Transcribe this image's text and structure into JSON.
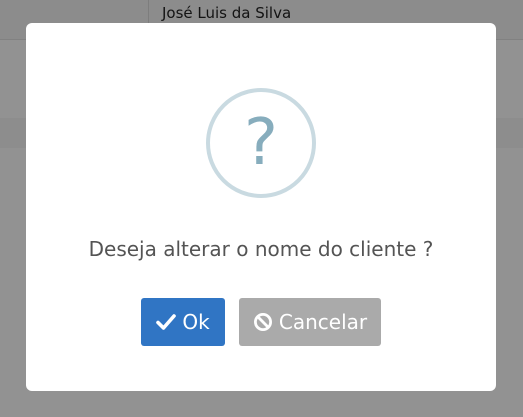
{
  "background": {
    "customer_name": "José Luis da Silva"
  },
  "dialog": {
    "icon": "question-icon",
    "icon_glyph": "?",
    "message": "Deseja alterar o nome do cliente ?",
    "ok_button": {
      "label": "Ok",
      "icon": "check-icon",
      "color": "#3075c4"
    },
    "cancel_button": {
      "label": "Cancelar",
      "icon": "ban-icon",
      "color": "#aaaaaa"
    }
  }
}
